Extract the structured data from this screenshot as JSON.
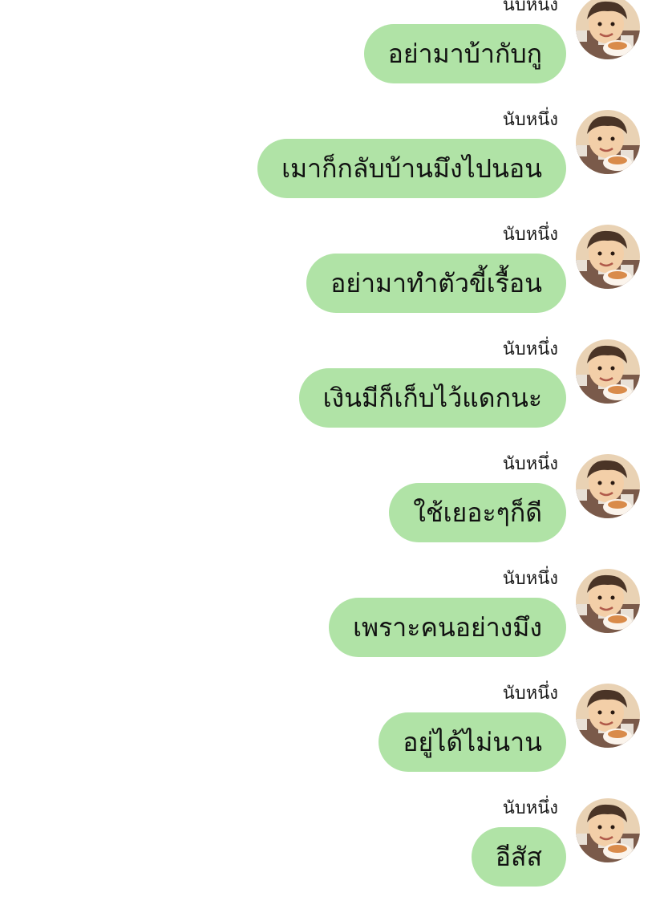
{
  "messages": [
    {
      "sender": "นับหนึ่ง",
      "text": "อย่ามาบ้ากับกู",
      "avatar_icon": "user-avatar-icon"
    },
    {
      "sender": "นับหนึ่ง",
      "text": "เมาก็กลับบ้านมึงไปนอน",
      "avatar_icon": "user-avatar-icon"
    },
    {
      "sender": "นับหนึ่ง",
      "text": "อย่ามาทำตัวขี้เรื้อน",
      "avatar_icon": "user-avatar-icon"
    },
    {
      "sender": "นับหนึ่ง",
      "text": "เงินมีก็เก็บไว้แดกนะ",
      "avatar_icon": "user-avatar-icon"
    },
    {
      "sender": "นับหนึ่ง",
      "text": "ใช้เยอะๆก็ดี",
      "avatar_icon": "user-avatar-icon"
    },
    {
      "sender": "นับหนึ่ง",
      "text": "เพราะคนอย่างมึง",
      "avatar_icon": "user-avatar-icon"
    },
    {
      "sender": "นับหนึ่ง",
      "text": "อยู่ได้ไม่นาน",
      "avatar_icon": "user-avatar-icon"
    },
    {
      "sender": "นับหนึ่ง",
      "text": "อีสัส",
      "avatar_icon": "user-avatar-icon"
    }
  ],
  "colors": {
    "bubble": "#b0e3a6",
    "background": "#ffffff",
    "text": "#111111"
  }
}
